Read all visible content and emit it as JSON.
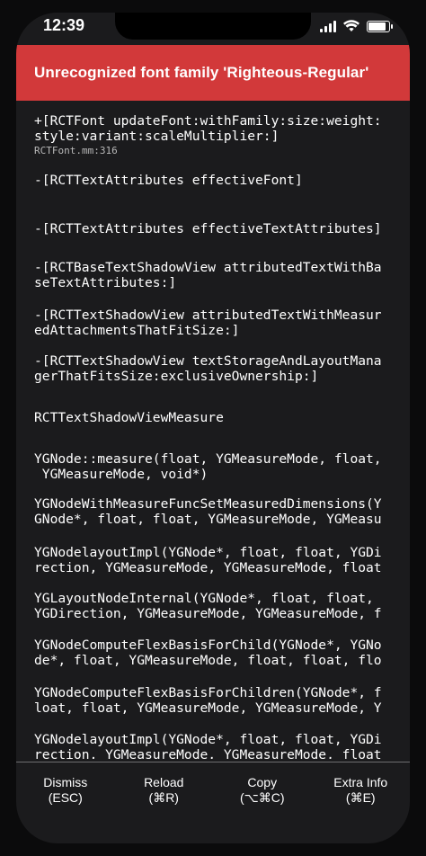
{
  "status_bar": {
    "time": "12:39"
  },
  "error": {
    "title": "Unrecognized font family 'Righteous-Regular'"
  },
  "stack": [
    {
      "lines": [
        "+[RCTFont updateFont:withFamily:size:weight:",
        "style:variant:scaleMultiplier:]"
      ],
      "file": "RCTFont.mm:316"
    },
    {
      "lines": [
        "-[RCTTextAttributes effectiveFont]"
      ]
    },
    {
      "lines": [
        "-[RCTTextAttributes effectiveTextAttributes]"
      ]
    },
    {
      "lines": [
        "-[RCTBaseTextShadowView attributedTextWithBa",
        "seTextAttributes:]"
      ]
    },
    {
      "lines": [
        "-[RCTTextShadowView attributedTextWithMeasur",
        "edAttachmentsThatFitSize:]"
      ]
    },
    {
      "lines": [
        "-[RCTTextShadowView textStorageAndLayoutMana",
        "gerThatFitsSize:exclusiveOwnership:]"
      ]
    },
    {
      "lines": [
        "RCTTextShadowViewMeasure"
      ]
    },
    {
      "lines": [
        "YGNode::measure(float, YGMeasureMode, float,",
        " YGMeasureMode, void*)"
      ]
    },
    {
      "lines": [
        "YGNodeWithMeasureFuncSetMeasuredDimensions(Y",
        "GNode*, float, float, YGMeasureMode, YGMeasu"
      ]
    },
    {
      "lines": [
        "YGNodelayoutImpl(YGNode*, float, float, YGDi",
        "rection, YGMeasureMode, YGMeasureMode, float"
      ]
    },
    {
      "lines": [
        "YGLayoutNodeInternal(YGNode*, float, float,",
        "YGDirection, YGMeasureMode, YGMeasureMode, f"
      ]
    },
    {
      "lines": [
        "YGNodeComputeFlexBasisForChild(YGNode*, YGNo",
        "de*, float, YGMeasureMode, float, float, flo"
      ]
    },
    {
      "lines": [
        "YGNodeComputeFlexBasisForChildren(YGNode*, f",
        "loat, float, YGMeasureMode, YGMeasureMode, Y"
      ]
    },
    {
      "lines": [
        "YGNodelayoutImpl(YGNode*, float, float, YGDi",
        "rection, YGMeasureMode, YGMeasureMode, float"
      ]
    }
  ],
  "footer": {
    "dismiss": {
      "label": "Dismiss",
      "shortcut": "(ESC)"
    },
    "reload": {
      "label": "Reload",
      "shortcut": "(⌘R)"
    },
    "copy": {
      "label": "Copy",
      "shortcut": "(⌥⌘C)"
    },
    "extra": {
      "label": "Extra Info",
      "shortcut": "(⌘E)"
    }
  },
  "colors": {
    "header": "#d2393a",
    "background": "#1b1b1d",
    "text": "#ffffff"
  }
}
